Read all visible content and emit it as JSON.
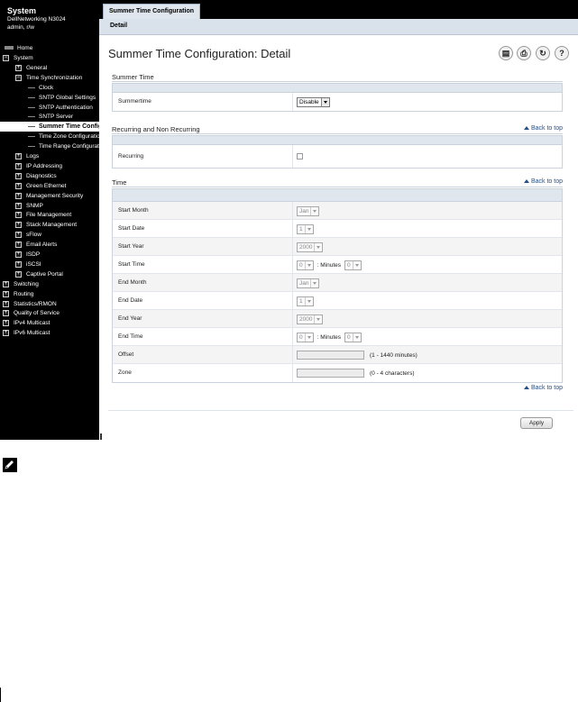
{
  "sidebar": {
    "system_title": "System",
    "model": "DellNetworking N3024",
    "user": "admin, r/w",
    "home_label": "Home",
    "tree": [
      {
        "label": "System",
        "level": 0,
        "exp": "−"
      },
      {
        "label": "General",
        "level": 1,
        "exp": "+"
      },
      {
        "label": "Time Synchronization",
        "level": 1,
        "exp": "−"
      },
      {
        "label": "Clock",
        "level": 2
      },
      {
        "label": "SNTP Global Settings",
        "level": 2
      },
      {
        "label": "SNTP Authentication",
        "level": 2
      },
      {
        "label": "SNTP Server",
        "level": 2
      },
      {
        "label": "Summer Time Configuration",
        "level": 2,
        "selected": true
      },
      {
        "label": "Time Zone Configuration",
        "level": 2
      },
      {
        "label": "Time Range Configuration",
        "level": 2
      },
      {
        "label": "Logs",
        "level": 1,
        "exp": "+"
      },
      {
        "label": "IP Addressing",
        "level": 1,
        "exp": "+"
      },
      {
        "label": "Diagnostics",
        "level": 1,
        "exp": "+"
      },
      {
        "label": "Green Ethernet",
        "level": 1,
        "exp": "+"
      },
      {
        "label": "Management Security",
        "level": 1,
        "exp": "+"
      },
      {
        "label": "SNMP",
        "level": 1,
        "exp": "+"
      },
      {
        "label": "File Management",
        "level": 1,
        "exp": "+"
      },
      {
        "label": "Stack Management",
        "level": 1,
        "exp": "+"
      },
      {
        "label": "sFlow",
        "level": 1,
        "exp": "+"
      },
      {
        "label": "Email Alerts",
        "level": 1,
        "exp": "+"
      },
      {
        "label": "ISDP",
        "level": 1,
        "exp": "+"
      },
      {
        "label": "iSCSI",
        "level": 1,
        "exp": "+"
      },
      {
        "label": "Captive Portal",
        "level": 1,
        "exp": "+"
      },
      {
        "label": "Switching",
        "level": 0,
        "exp": "+"
      },
      {
        "label": "Routing",
        "level": 0,
        "exp": "+"
      },
      {
        "label": "Statistics/RMON",
        "level": 0,
        "exp": "+"
      },
      {
        "label": "Quality of Service",
        "level": 0,
        "exp": "+"
      },
      {
        "label": "IPv4 Multicast",
        "level": 0,
        "exp": "+"
      },
      {
        "label": "IPv6 Multicast",
        "level": 0,
        "exp": "+"
      }
    ]
  },
  "header": {
    "tab_label": "Summer Time Configuration",
    "subtab_label": "Detail",
    "page_title": "Summer Time Configuration: Detail",
    "icons": [
      "save-icon",
      "print-icon",
      "refresh-icon",
      "help-icon"
    ]
  },
  "sections": {
    "summer_time": {
      "title": "Summer Time",
      "summertime_label": "Summertime",
      "summertime_value": "Disable"
    },
    "recurring": {
      "title": "Recurring and Non Recurring",
      "back_to_top": "Back to top",
      "recurring_label": "Recurring"
    },
    "time": {
      "title": "Time",
      "back_to_top": "Back to top",
      "start_month_label": "Start Month",
      "start_month_value": "Jan",
      "start_date_label": "Start Date",
      "start_date_value": "1",
      "start_year_label": "Start Year",
      "start_year_value": "2000",
      "start_time_label": "Start Time",
      "start_hour_value": "0",
      "start_minutes_label": ": Minutes",
      "start_minutes_value": "0",
      "end_month_label": "End Month",
      "end_month_value": "Jan",
      "end_date_label": "End Date",
      "end_date_value": "1",
      "end_year_label": "End Year",
      "end_year_value": "2000",
      "end_time_label": "End Time",
      "end_hour_value": "0",
      "end_minutes_label": ": Minutes",
      "end_minutes_value": "0",
      "offset_label": "Offset",
      "offset_value": "",
      "offset_hint": "(1 - 1440 minutes)",
      "zone_label": "Zone",
      "zone_value": "",
      "zone_hint": "(0 - 4 characters)"
    },
    "bottom_back_to_top": "Back to top"
  },
  "apply_label": "Apply"
}
